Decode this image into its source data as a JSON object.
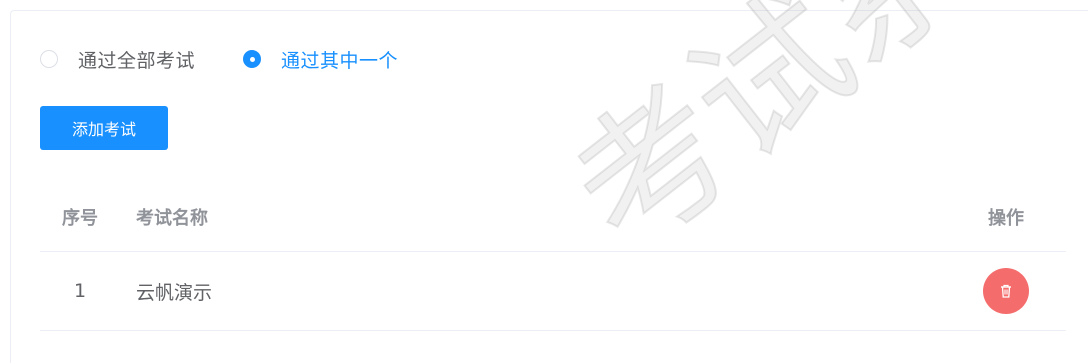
{
  "pass_mode": {
    "options": [
      {
        "label": "通过全部考试",
        "checked": false
      },
      {
        "label": "通过其中一个",
        "checked": true
      }
    ]
  },
  "toolbar": {
    "add_exam_label": "添加考试"
  },
  "table": {
    "columns": {
      "index": "序号",
      "name": "考试名称",
      "ops": "操作"
    },
    "rows": [
      {
        "index": "1",
        "name": "云帆演示"
      }
    ]
  },
  "watermark": {
    "text": "考试系统"
  },
  "colors": {
    "primary": "#1890ff",
    "danger": "#f56c6c"
  },
  "icons": {
    "delete": "trash-icon"
  }
}
